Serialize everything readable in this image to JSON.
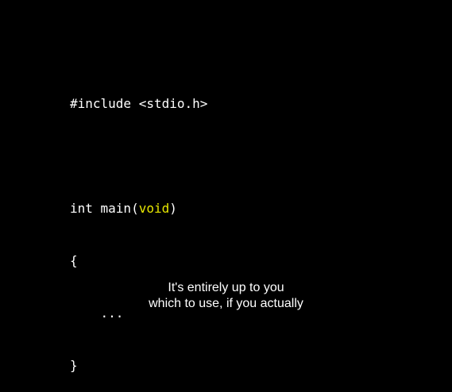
{
  "code": {
    "include_line": "#include <stdio.h>",
    "main_prefix": "int main(",
    "main_param": "void",
    "main_suffix": ")",
    "open_brace": "{",
    "body_placeholder": "    ...",
    "close_brace": "}"
  },
  "subtitle": {
    "line1": "It's entirely up to you",
    "line2": "which to use, if you actually"
  },
  "colors": {
    "background": "#000000",
    "text": "#ffffff",
    "keyword_highlight": "#e6e600"
  }
}
